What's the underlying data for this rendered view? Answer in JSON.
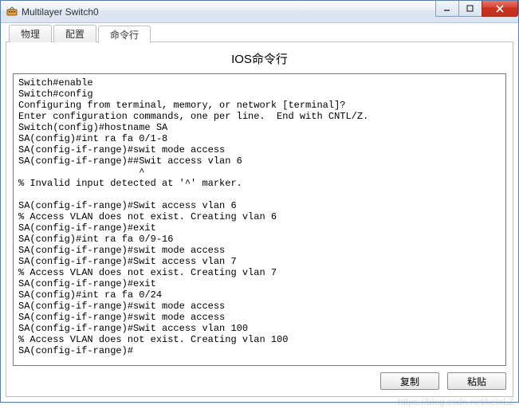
{
  "window": {
    "title": "Multilayer Switch0"
  },
  "tabs": {
    "items": [
      "物理",
      "配置",
      "命令行"
    ],
    "active_index": 2
  },
  "panel": {
    "title": "IOS命令行"
  },
  "terminal": {
    "text": "Switch#enable\nSwitch#config\nConfiguring from terminal, memory, or network [terminal]?\nEnter configuration commands, one per line.  End with CNTL/Z.\nSwitch(config)#hostname SA\nSA(config)#int ra fa 0/1-8\nSA(config-if-range)#swit mode access\nSA(config-if-range)##Swit access vlan 6\n                     ^\n% Invalid input detected at '^' marker.\n\nSA(config-if-range)#Swit access vlan 6\n% Access VLAN does not exist. Creating vlan 6\nSA(config-if-range)#exit\nSA(config)#int ra fa 0/9-16\nSA(config-if-range)#swit mode access\nSA(config-if-range)#Swit access vlan 7\n% Access VLAN does not exist. Creating vlan 7\nSA(config-if-range)#exit\nSA(config)#int ra fa 0/24\nSA(config-if-range)#swit mode access\nSA(config-if-range)#swit mode access\nSA(config-if-range)#Swit access vlan 100\n% Access VLAN does not exist. Creating vlan 100\nSA(config-if-range)#"
  },
  "buttons": {
    "copy": "复制",
    "paste": "粘贴"
  },
  "watermark": "https://blog.csdn.net/kelxLZ"
}
